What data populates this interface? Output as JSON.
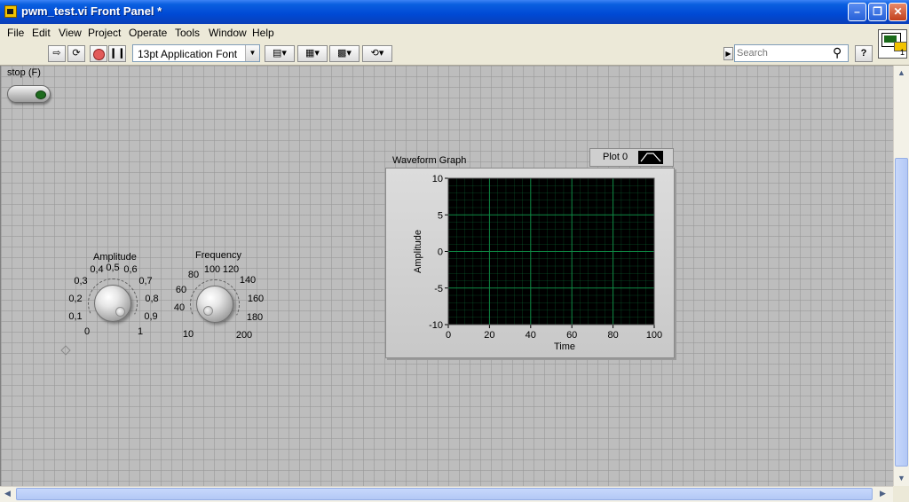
{
  "window": {
    "title": "pwm_test.vi Front Panel *"
  },
  "menu": [
    "File",
    "Edit",
    "View",
    "Project",
    "Operate",
    "Tools",
    "Window",
    "Help"
  ],
  "toolbar": {
    "font": "13pt Application Font",
    "search_placeholder": "Search"
  },
  "vi_icon": {
    "label": "1"
  },
  "stop": {
    "label": "stop (F)"
  },
  "amplitude": {
    "label": "Amplitude",
    "ticks": [
      "0",
      "0,1",
      "0,2",
      "0,3",
      "0,4",
      "0,5",
      "0,6",
      "0,7",
      "0,8",
      "0,9",
      "1"
    ]
  },
  "frequency": {
    "label": "Frequency",
    "ticks": [
      "10",
      "40",
      "60",
      "80",
      "100",
      "120",
      "140",
      "160",
      "180",
      "200"
    ]
  },
  "graph": {
    "label": "Waveform Graph",
    "legend": "Plot 0",
    "x_axis": {
      "label": "Time",
      "ticks": [
        "0",
        "20",
        "40",
        "60",
        "80",
        "100"
      ]
    },
    "y_axis": {
      "label": "Amplitude",
      "ticks": [
        "10",
        "5",
        "0",
        "-5",
        "-10"
      ]
    },
    "colors": {
      "plot_bg": "#000000",
      "grid": "#0f8a45"
    }
  }
}
